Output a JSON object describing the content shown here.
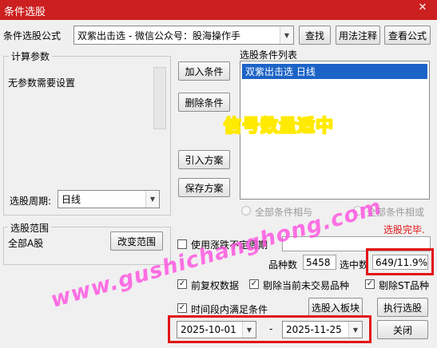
{
  "window": {
    "title": "条件选股",
    "close_icon": "close-icon"
  },
  "formula": {
    "label": "条件选股公式",
    "value": "双紫出击选  -  微信公众号：股海操作手"
  },
  "buttons": {
    "find": "查找",
    "usage": "用法注释",
    "view_formula": "查看公式",
    "add_condition": "加入条件",
    "delete_condition": "删除条件",
    "import_plan": "引入方案",
    "save_plan": "保存方案",
    "change_range": "改变范围",
    "to_block": "选股入板块",
    "execute": "执行选股",
    "close": "关闭"
  },
  "params": {
    "group_title": "计算参数",
    "empty_text": "无参数需要设置",
    "period_label": "选股周期:",
    "period_value": "日线"
  },
  "condition_list": {
    "title": "选股条件列表",
    "items": [
      "双紫出击选  日线"
    ]
  },
  "overlay_text": "信号数量适中",
  "logic": {
    "and_label": "全部条件相与",
    "or_label": "全部条件相或"
  },
  "status": {
    "done": "选股完毕."
  },
  "range": {
    "group_title": "选股范围",
    "value": "全部A股"
  },
  "options": {
    "variable_period": {
      "label": "使用涨跌不定周期",
      "checked": false,
      "value": ""
    },
    "adjusted": {
      "label": "前复权数据",
      "checked": true
    },
    "exclude_untraded": {
      "label": "剔除当前未交易品种",
      "checked": true
    },
    "exclude_st": {
      "label": "剔除ST品种",
      "checked": true
    },
    "time_range": {
      "label": "时间段内满足条件",
      "checked": true
    }
  },
  "stats": {
    "count_label": "品种数",
    "count_value": "5458",
    "selected_label": "选中数",
    "selected_value": "649/11.9%"
  },
  "dates": {
    "start": "2025-10-01",
    "separator": "-",
    "end": "2025-11-25"
  },
  "watermark": "www.gushichanghong.com",
  "colors": {
    "titlebar": "#cc1f1f",
    "highlight": "#e31414",
    "selection": "#1c63c7",
    "overlay_text": "#ff2a1a",
    "watermark": "#ff4fe0"
  }
}
